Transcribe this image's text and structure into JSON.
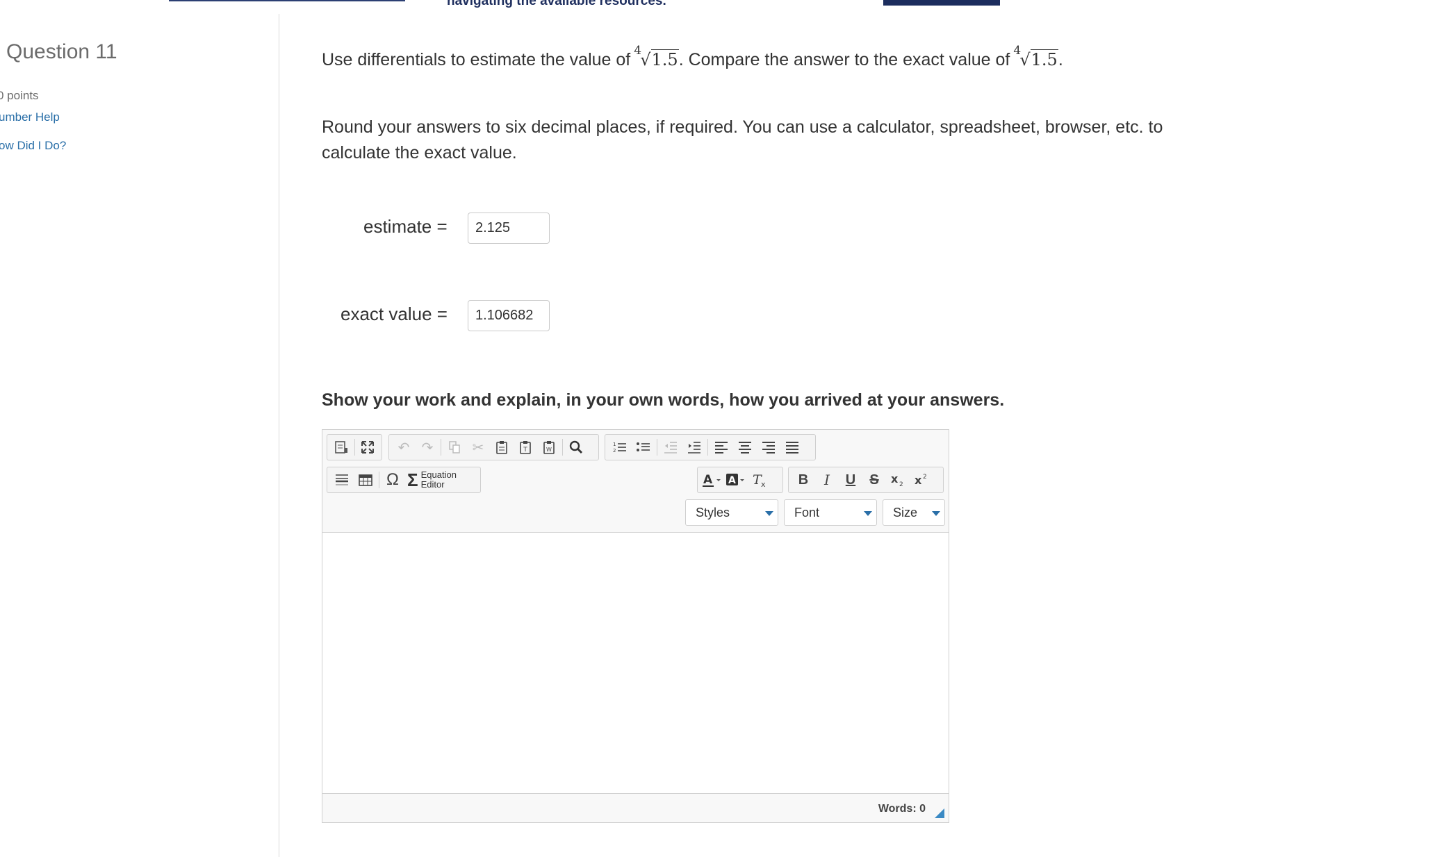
{
  "banner": {
    "text": "navigating the available resources."
  },
  "sidebar": {
    "title": "Question 11",
    "points": "0 points",
    "links": [
      "umber Help",
      "ow Did I Do?"
    ]
  },
  "question": {
    "text_before": "Use differentials to estimate the value of",
    "text_middle": ". Compare the answer to the exact value of",
    "text_after": ".",
    "root_index": "4",
    "radicand": "1.5",
    "instructions": "Round your answers to six decimal places, if required. You can use a calculator, spreadsheet, browser, etc. to calculate the exact value."
  },
  "answers": [
    {
      "label": "estimate =",
      "value": "2.125"
    },
    {
      "label": "exact value =",
      "value": "1.106682"
    }
  ],
  "work": {
    "heading": "Show your work and explain, in your own words, how you arrived at your answers."
  },
  "editor": {
    "equation_editor_line1": "Equation",
    "equation_editor_line2": "Editor",
    "styles_label": "Styles",
    "font_label": "Font",
    "size_label": "Size",
    "word_count": "Words: 0",
    "icons": {
      "row1": [
        "source-icon",
        "maximize-icon",
        "undo-icon",
        "redo-icon",
        "copy-icon",
        "cut-icon",
        "paste-icon",
        "paste-text-icon",
        "paste-word-icon",
        "find-icon",
        "numbered-list-icon",
        "bulleted-list-icon",
        "outdent-icon",
        "indent-icon",
        "align-left-icon",
        "align-center-icon",
        "align-right-icon",
        "justify-icon"
      ],
      "row2": [
        "horizontal-rule-icon",
        "table-icon",
        "omega-icon",
        "sigma-icon",
        "text-color-icon",
        "background-color-icon",
        "remove-format-icon",
        "bold-icon",
        "italic-icon",
        "underline-icon",
        "strikethrough-icon",
        "subscript-icon",
        "superscript-icon"
      ]
    }
  }
}
